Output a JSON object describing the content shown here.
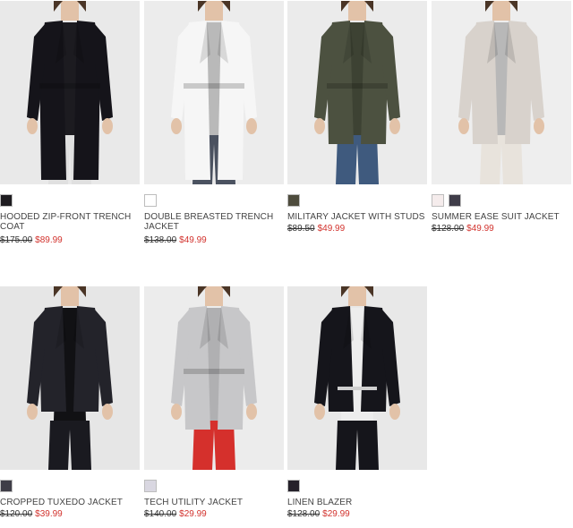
{
  "products": [
    {
      "name": "HOODED ZIP-FRONT TRENCH COAT",
      "old_price": "$175.00",
      "sale_price": "$89.99",
      "swatches": [
        "#1e1c20"
      ],
      "photo": {
        "bg": "#e9e9e9",
        "top": "#15141a",
        "inner": "#1c1b20",
        "bottom": "#e0e0e0",
        "style": "coat"
      }
    },
    {
      "name": "DOUBLE BREASTED TRENCH JACKET",
      "old_price": "$138.00",
      "sale_price": "$49.99",
      "swatches": [
        "#ffffff"
      ],
      "photo": {
        "bg": "#ececec",
        "top": "#f6f6f6",
        "inner": "#b9b9b9",
        "bottom": "#4b5260",
        "style": "trench"
      }
    },
    {
      "name": "MILITARY JACKET WITH STUDS",
      "old_price": "$89.50",
      "sale_price": "$49.99",
      "swatches": [
        "#4e4c3d"
      ],
      "photo": {
        "bg": "#ebebeb",
        "top": "#4c5140",
        "inner": "#3d4233",
        "bottom": "#3f5a7e",
        "style": "military"
      }
    },
    {
      "name": "SUMMER EASE SUIT JACKET",
      "old_price": "$128.00",
      "sale_price": "$49.99",
      "swatches": [
        "#f5ecec",
        "#3f3d49"
      ],
      "photo": {
        "bg": "#eeeeee",
        "top": "#d8d2cc",
        "inner": "#b8b8b8",
        "bottom": "#e8e3dc",
        "style": "suit"
      }
    },
    {
      "name": "CROPPED TUXEDO JACKET",
      "old_price": "$120.00",
      "sale_price": "$39.99",
      "swatches": [
        "#3f3e47"
      ],
      "photo": {
        "bg": "#e6e6e6",
        "top": "#23232a",
        "inner": "#111114",
        "bottom": "#1a1a20",
        "style": "tux"
      }
    },
    {
      "name": "TECH UTILITY JACKET",
      "old_price": "$140.00",
      "sale_price": "$29.99",
      "swatches": [
        "#d9d7e1"
      ],
      "photo": {
        "bg": "#ececec",
        "top": "#c7c7c9",
        "inner": "#b0b0b2",
        "bottom": "#d5302c",
        "style": "utility"
      }
    },
    {
      "name": "LINEN BLAZER",
      "old_price": "$128.00",
      "sale_price": "$29.99",
      "swatches": [
        "#25212a"
      ],
      "photo": {
        "bg": "#e8e8e8",
        "top": "#15151b",
        "inner": "#ededed",
        "bottom": "#15151b",
        "style": "blazer"
      }
    }
  ]
}
